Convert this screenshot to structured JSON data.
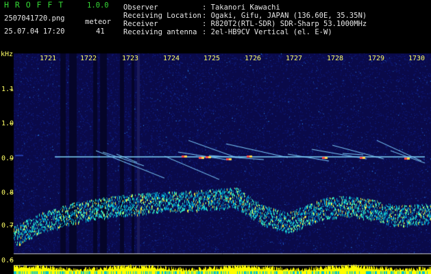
{
  "header": {
    "app_name": "H R O F F T",
    "version": "1.0.0",
    "filename": "2507041720.png",
    "datetime": "25.07.04 17:20",
    "count_label": "meteor",
    "count_value": "41",
    "fields": [
      {
        "label": "Observer",
        "value": ": Takanori Kawachi"
      },
      {
        "label": "Receiving Location",
        "value": ": Ogaki, Gifu, JAPAN (136.60E, 35.35N)"
      },
      {
        "label": "Receiver",
        "value": ": R820T2(RTL-SDR) SDR-Sharp 53.1000MHz"
      },
      {
        "label": "Receiving antenna",
        "value": ": 2el-HB9CV Vertical (el. E-W)"
      }
    ]
  },
  "axes": {
    "y_unit": "kHz",
    "y_ticks": [
      "1.1",
      "1.0",
      "0.9",
      "0.8",
      "0.7",
      "0.6"
    ],
    "x_ticks": [
      "1721",
      "1722",
      "1723",
      "1724",
      "1725",
      "1726",
      "1727",
      "1728",
      "1729",
      "1730"
    ]
  },
  "colors": {
    "background": "#000000",
    "spectrogram_bg": "#0a0a4a",
    "axis_text": "#ffff66",
    "header_text": "#e8e8e8",
    "title_green": "#35d835",
    "echo_line": "#7fd8ff",
    "meteor_pos": "#ffd84a",
    "noise_band": "#00c8c8",
    "level_bar": "#ffff00"
  }
}
